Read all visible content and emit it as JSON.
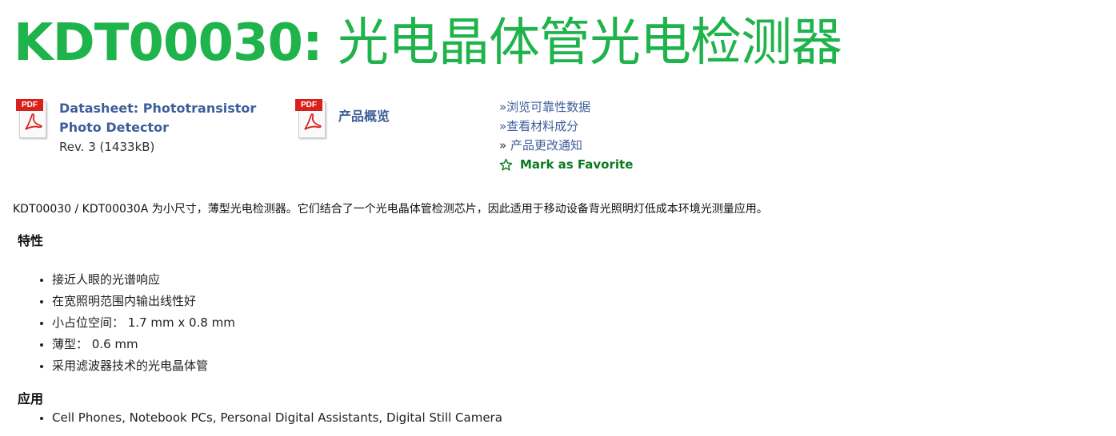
{
  "header": {
    "title_code": "KDT00030:",
    "title_name": " 光电晶体管光电检测器"
  },
  "documents": [
    {
      "icon": "pdf-icon",
      "icon_label": "PDF",
      "link_line1": "Datasheet: Phototransistor",
      "link_line2": "Photo Detector",
      "rev": "Rev. 3 (1433kB)"
    },
    {
      "icon": "pdf-icon",
      "icon_label": "PDF",
      "link": "产品概览"
    }
  ],
  "side_links": {
    "reliability": "»浏览可靠性数据",
    "materials": "»查看材料成分",
    "pcn_prefix": "» ",
    "pcn": "产品更改通知",
    "favorite": "Mark as Favorite"
  },
  "intro": "KDT00030 / KDT00030A 为小尺寸，薄型光电检测器。它们结合了一个光电晶体管检测芯片，因此适用于移动设备背光照明灯低成本环境光测量应用。",
  "features": {
    "heading": "特性",
    "items": [
      "接近人眼的光谱响应",
      "在宽照明范围内输出线性好",
      "小占位空间： 1.7 mm x 0.8 mm",
      "薄型： 0.6 mm",
      "采用滤波器技术的光电晶体管"
    ]
  },
  "applications": {
    "heading": "应用",
    "items": [
      "Cell Phones, Notebook PCs, Personal Digital Assistants, Digital Still Camera"
    ]
  },
  "colors": {
    "title_green": "#1fb34b",
    "link_blue": "#3e5e9a",
    "favorite_green": "#0b7a20",
    "pdf_red": "#d8211d"
  }
}
